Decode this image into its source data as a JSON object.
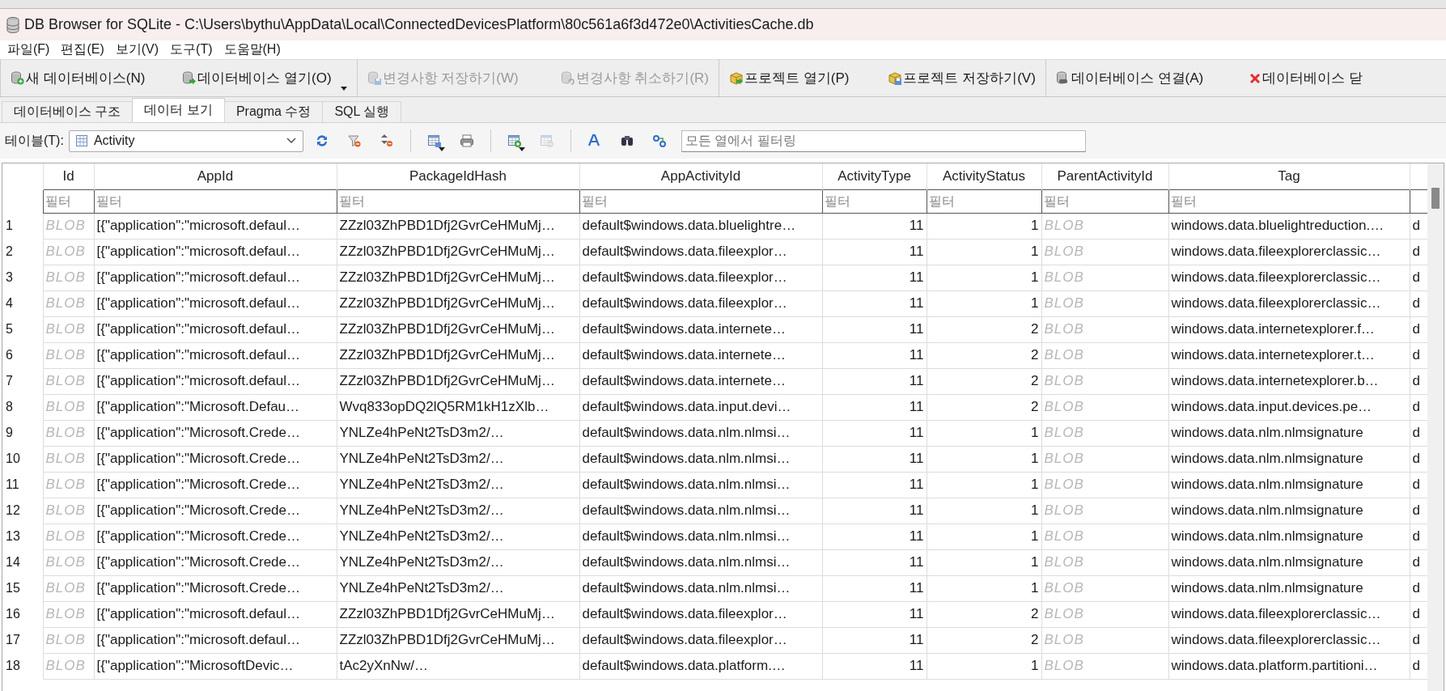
{
  "window": {
    "title": "DB Browser for SQLite - C:\\Users\\bythu\\AppData\\Local\\ConnectedDevicesPlatform\\80c561a6f3d472e0\\ActivitiesCache.db"
  },
  "menu": [
    "파일(F)",
    "편집(E)",
    "보기(V)",
    "도구(T)",
    "도움말(H)"
  ],
  "toolbar": [
    [
      {
        "label": "새 데이터베이스(N)",
        "disabled": false,
        "dropdown": false
      },
      {
        "label": "데이터베이스 열기(O)",
        "disabled": false,
        "dropdown": true
      }
    ],
    [
      {
        "label": "변경사항 저장하기(W)",
        "disabled": true,
        "dropdown": false
      },
      {
        "label": "변경사항 취소하기(R)",
        "disabled": true,
        "dropdown": false
      }
    ],
    [
      {
        "label": "프로젝트 열기(P)",
        "disabled": false,
        "dropdown": false
      },
      {
        "label": "프로젝트 저장하기(V)",
        "disabled": false,
        "dropdown": false
      }
    ],
    [
      {
        "label": "데이터베이스 연결(A)",
        "disabled": false,
        "dropdown": false
      },
      {
        "label": "데이터베이스 닫",
        "disabled": false,
        "dropdown": false
      }
    ]
  ],
  "tabs": [
    {
      "label": "데이터베이스 구조",
      "selected": false
    },
    {
      "label": "데이터 보기",
      "selected": true
    },
    {
      "label": "Pragma 수정",
      "selected": false
    },
    {
      "label": "SQL 실행",
      "selected": false
    }
  ],
  "browse_toolbar": {
    "table_label": "테이블(T):",
    "table": "Activity",
    "filter_placeholder": "모든 열에서 필터링",
    "tools": [
      [
        {
          "disabled": false,
          "dropdown": false
        },
        {
          "disabled": false,
          "dropdown": false
        },
        {
          "disabled": false,
          "dropdown": false
        }
      ],
      [
        {
          "disabled": false,
          "dropdown": true
        },
        {
          "disabled": false,
          "dropdown": false
        }
      ],
      [
        {
          "disabled": false,
          "dropdown": true
        },
        {
          "disabled": true,
          "dropdown": false
        }
      ],
      [
        {
          "disabled": false,
          "dropdown": false
        },
        {
          "disabled": false,
          "dropdown": false
        },
        {
          "disabled": false,
          "dropdown": false
        }
      ]
    ]
  },
  "grid": {
    "columns": [
      {
        "header": "Id",
        "kind": "blob",
        "filter_placeholder": "필터"
      },
      {
        "header": "AppId",
        "kind": "text",
        "filter_placeholder": "필터"
      },
      {
        "header": "PackageIdHash",
        "kind": "text",
        "filter_placeholder": "필터"
      },
      {
        "header": "AppActivityId",
        "kind": "text",
        "filter_placeholder": "필터"
      },
      {
        "header": "ActivityType",
        "kind": "number",
        "filter_placeholder": "필터"
      },
      {
        "header": "ActivityStatus",
        "kind": "number",
        "filter_placeholder": "필터"
      },
      {
        "header": "ParentActivityId",
        "kind": "blob",
        "filter_placeholder": "필터"
      },
      {
        "header": "Tag",
        "kind": "text",
        "filter_placeholder": "필터"
      },
      {
        "kind": "text"
      }
    ],
    "rows": [
      {
        "number": "1",
        "cells": [
          "BLOB",
          "[{\"application\":\"microsoft.defaul…",
          "ZZzl03ZhPBD1Dfj2GvrCeHMuMj…",
          "default$windows.data.bluelightre…",
          "11",
          "1",
          "BLOB",
          "windows.data.bluelightreduction.…",
          "d"
        ]
      },
      {
        "number": "2",
        "cells": [
          "BLOB",
          "[{\"application\":\"microsoft.defaul…",
          "ZZzl03ZhPBD1Dfj2GvrCeHMuMj…",
          "default$windows.data.fileexplor…",
          "11",
          "1",
          "BLOB",
          "windows.data.fileexplorerclassic…",
          "d"
        ]
      },
      {
        "number": "3",
        "cells": [
          "BLOB",
          "[{\"application\":\"microsoft.defaul…",
          "ZZzl03ZhPBD1Dfj2GvrCeHMuMj…",
          "default$windows.data.fileexplor…",
          "11",
          "1",
          "BLOB",
          "windows.data.fileexplorerclassic…",
          "d"
        ]
      },
      {
        "number": "4",
        "cells": [
          "BLOB",
          "[{\"application\":\"microsoft.defaul…",
          "ZZzl03ZhPBD1Dfj2GvrCeHMuMj…",
          "default$windows.data.fileexplor…",
          "11",
          "1",
          "BLOB",
          "windows.data.fileexplorerclassic…",
          "d"
        ]
      },
      {
        "number": "5",
        "cells": [
          "BLOB",
          "[{\"application\":\"microsoft.defaul…",
          "ZZzl03ZhPBD1Dfj2GvrCeHMuMj…",
          "default$windows.data.internete…",
          "11",
          "2",
          "BLOB",
          "windows.data.internetexplorer.f…",
          "d"
        ]
      },
      {
        "number": "6",
        "cells": [
          "BLOB",
          "[{\"application\":\"microsoft.defaul…",
          "ZZzl03ZhPBD1Dfj2GvrCeHMuMj…",
          "default$windows.data.internete…",
          "11",
          "2",
          "BLOB",
          "windows.data.internetexplorer.t…",
          "d"
        ]
      },
      {
        "number": "7",
        "cells": [
          "BLOB",
          "[{\"application\":\"microsoft.defaul…",
          "ZZzl03ZhPBD1Dfj2GvrCeHMuMj…",
          "default$windows.data.internete…",
          "11",
          "2",
          "BLOB",
          "windows.data.internetexplorer.b…",
          "d"
        ]
      },
      {
        "number": "8",
        "cells": [
          "BLOB",
          "[{\"application\":\"Microsoft.Defau…",
          "Wvq833opDQ2lQ5RM1kH1zXlb…",
          "default$windows.data.input.devi…",
          "11",
          "2",
          "BLOB",
          "windows.data.input.devices.pe…",
          "d"
        ]
      },
      {
        "number": "9",
        "cells": [
          "BLOB",
          "[{\"application\":\"Microsoft.Crede…",
          "YNLZe4hPeNt2TsD3m2/…",
          "default$windows.data.nlm.nlmsi…",
          "11",
          "1",
          "BLOB",
          "windows.data.nlm.nlmsignature",
          "d"
        ]
      },
      {
        "number": "10",
        "cells": [
          "BLOB",
          "[{\"application\":\"Microsoft.Crede…",
          "YNLZe4hPeNt2TsD3m2/…",
          "default$windows.data.nlm.nlmsi…",
          "11",
          "1",
          "BLOB",
          "windows.data.nlm.nlmsignature",
          "d"
        ]
      },
      {
        "number": "11",
        "cells": [
          "BLOB",
          "[{\"application\":\"Microsoft.Crede…",
          "YNLZe4hPeNt2TsD3m2/…",
          "default$windows.data.nlm.nlmsi…",
          "11",
          "1",
          "BLOB",
          "windows.data.nlm.nlmsignature",
          "d"
        ]
      },
      {
        "number": "12",
        "cells": [
          "BLOB",
          "[{\"application\":\"Microsoft.Crede…",
          "YNLZe4hPeNt2TsD3m2/…",
          "default$windows.data.nlm.nlmsi…",
          "11",
          "1",
          "BLOB",
          "windows.data.nlm.nlmsignature",
          "d"
        ]
      },
      {
        "number": "13",
        "cells": [
          "BLOB",
          "[{\"application\":\"Microsoft.Crede…",
          "YNLZe4hPeNt2TsD3m2/…",
          "default$windows.data.nlm.nlmsi…",
          "11",
          "1",
          "BLOB",
          "windows.data.nlm.nlmsignature",
          "d"
        ]
      },
      {
        "number": "14",
        "cells": [
          "BLOB",
          "[{\"application\":\"Microsoft.Crede…",
          "YNLZe4hPeNt2TsD3m2/…",
          "default$windows.data.nlm.nlmsi…",
          "11",
          "1",
          "BLOB",
          "windows.data.nlm.nlmsignature",
          "d"
        ]
      },
      {
        "number": "15",
        "cells": [
          "BLOB",
          "[{\"application\":\"Microsoft.Crede…",
          "YNLZe4hPeNt2TsD3m2/…",
          "default$windows.data.nlm.nlmsi…",
          "11",
          "1",
          "BLOB",
          "windows.data.nlm.nlmsignature",
          "d"
        ]
      },
      {
        "number": "16",
        "cells": [
          "BLOB",
          "[{\"application\":\"microsoft.defaul…",
          "ZZzl03ZhPBD1Dfj2GvrCeHMuMj…",
          "default$windows.data.fileexplor…",
          "11",
          "2",
          "BLOB",
          "windows.data.fileexplorerclassic…",
          "d"
        ]
      },
      {
        "number": "17",
        "cells": [
          "BLOB",
          "[{\"application\":\"microsoft.defaul…",
          "ZZzl03ZhPBD1Dfj2GvrCeHMuMj…",
          "default$windows.data.fileexplor…",
          "11",
          "2",
          "BLOB",
          "windows.data.fileexplorerclassic…",
          "d"
        ]
      },
      {
        "number": "18",
        "cells": [
          "BLOB",
          "[{\"application\":\"MicrosoftDevic…",
          "tAc2yXnNw/…",
          "default$windows.data.platform.…",
          "11",
          "1",
          "BLOB",
          "windows.data.platform.partitioni…",
          "d"
        ]
      }
    ]
  }
}
